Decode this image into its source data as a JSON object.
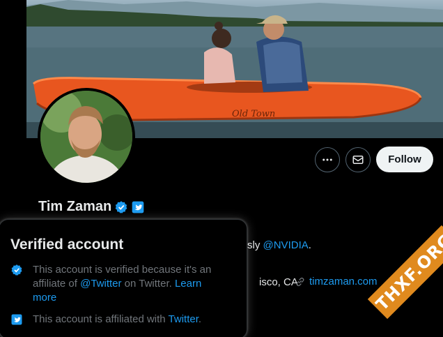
{
  "profile": {
    "name": "Tim Zaman",
    "follow_label": "Follow",
    "bio_fragment": "sly ",
    "bio_link": "@NVIDIA",
    "bio_end": ".",
    "location_fragment": "isco, CA",
    "website": "timzaman.com",
    "kayak_text": "Old Town"
  },
  "popover": {
    "title": "Verified account",
    "row1_text_a": "This account is verified because it's an affiliate of ",
    "row1_link": "@Twitter",
    "row1_text_b": " on Twitter. ",
    "row1_learn": "Learn more",
    "row2_text": "This account is affiliated with ",
    "row2_link": "Twitter",
    "row2_end": "."
  },
  "watermark": "THXF.ORG",
  "colors": {
    "accent": "#1d9bf0",
    "background": "#000000",
    "text_primary": "#e7e9ea",
    "text_secondary": "#71767b",
    "follow_bg": "#eff3f4",
    "watermark_bg": "#e08a1e"
  },
  "icons": [
    "more-icon",
    "mail-icon",
    "verified-badge-icon",
    "twitter-affiliate-icon",
    "link-icon"
  ]
}
